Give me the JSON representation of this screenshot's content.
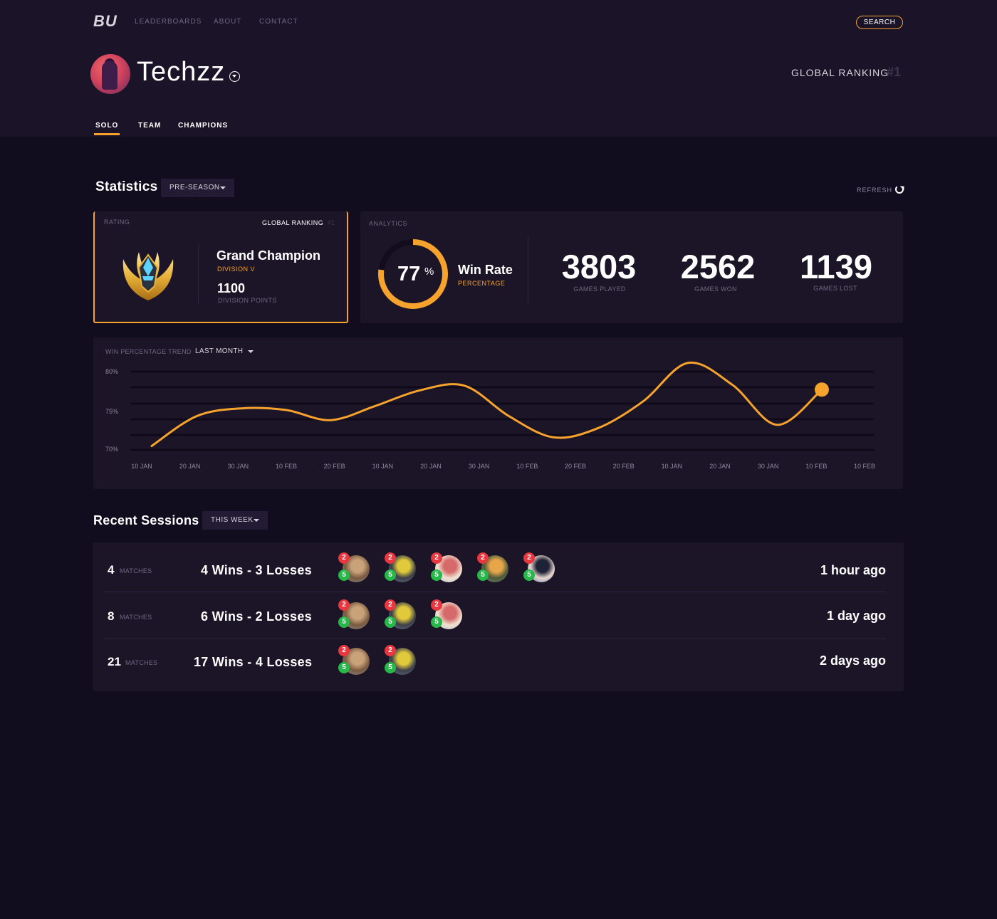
{
  "header": {
    "logo": "BU",
    "nav": [
      "LEADERBOARDS",
      "ABOUT",
      "CONTACT"
    ],
    "search_label": "SEARCH",
    "username": "Techzz",
    "global_ranking_label": "GLOBAL RANKING",
    "global_ranking_value": "#1",
    "tabs": [
      "SOLO",
      "TEAM",
      "CHAMPIONS"
    ],
    "active_tab": "SOLO"
  },
  "statistics": {
    "title": "Statistics",
    "season_dropdown": "PRE-SEASON",
    "refresh_label": "REFRESH",
    "rating": {
      "section_label": "RATING",
      "global_ranking_label": "GLOBAL RANKING",
      "global_ranking_value": "#1",
      "rank_name": "Grand Champion",
      "division": "DIVISION V",
      "points": "1100",
      "points_label": "DIVISION POINTS"
    },
    "analytics": {
      "section_label": "ANALYTICS",
      "win_rate_value": "77",
      "win_rate_percent_sign": "%",
      "win_rate_fraction": 0.77,
      "win_rate_label": "Win Rate",
      "win_rate_sub": "PERCENTAGE",
      "games_played": "3803",
      "games_played_label": "GAMES PLAYED",
      "games_won": "2562",
      "games_won_label": "GAMES WON",
      "games_lost": "1139",
      "games_lost_label": "GAMES LOST"
    },
    "accent_color": "#f5a32d"
  },
  "trend": {
    "label": "WIN PERCENTAGE TREND",
    "range_dropdown": "LAST MONTH"
  },
  "chart_data": {
    "type": "line",
    "x": [
      "10 JAN",
      "20 JAN",
      "30 JAN",
      "10 FEB",
      "20 FEB",
      "10 JAN",
      "20 JAN",
      "30 JAN",
      "10 FEB",
      "20 FEB",
      "20 FEB",
      "10 JAN",
      "20 JAN",
      "30 JAN",
      "10 FEB",
      "10 FEB"
    ],
    "y_ticks": [
      "80%",
      "75%",
      "70%"
    ],
    "ylim": [
      70,
      80
    ],
    "series": [
      {
        "values": [
          70.5,
          74.3,
          75.3,
          75.1,
          73.8,
          75.6,
          77.6,
          78.2,
          74.3,
          71.6,
          72.8,
          76.2,
          81.1,
          78.3,
          73.2,
          77.7
        ]
      }
    ],
    "line_color": "#f5a32d",
    "grid": true
  },
  "sessions": {
    "title": "Recent Sessions",
    "range_dropdown": "THIS WEEK",
    "matches_label": "MATCHES",
    "rows": [
      {
        "count": "4",
        "result": "4 Wins - 3 Losses",
        "time": "1 hour ago",
        "champions": [
          {
            "icon": "champion-dwarf-icon",
            "losses": "2",
            "wins": "5"
          },
          {
            "icon": "champion-griffin-icon",
            "losses": "2",
            "wins": "5"
          },
          {
            "icon": "champion-mage-icon",
            "losses": "2",
            "wins": "5"
          },
          {
            "icon": "champion-archer-icon",
            "losses": "2",
            "wins": "5"
          },
          {
            "icon": "champion-witch-icon",
            "losses": "2",
            "wins": "5"
          }
        ]
      },
      {
        "count": "8",
        "result": "6 Wins - 2 Losses",
        "time": "1 day ago",
        "champions": [
          {
            "icon": "champion-dwarf-icon",
            "losses": "2",
            "wins": "5"
          },
          {
            "icon": "champion-griffin-icon",
            "losses": "2",
            "wins": "5"
          },
          {
            "icon": "champion-mage-icon",
            "losses": "2",
            "wins": "5"
          }
        ]
      },
      {
        "count": "21",
        "result": "17 Wins - 4 Losses",
        "time": "2 days ago",
        "champions": [
          {
            "icon": "champion-dwarf-icon",
            "losses": "2",
            "wins": "5"
          },
          {
            "icon": "champion-griffin-icon",
            "losses": "2",
            "wins": "5"
          }
        ]
      }
    ]
  }
}
